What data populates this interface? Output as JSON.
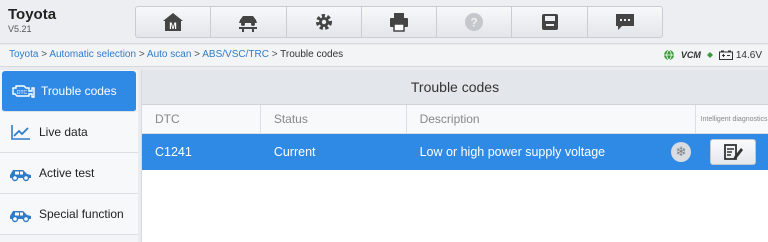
{
  "app": {
    "title": "Toyota",
    "version": "V5.21"
  },
  "toolbar": {
    "buttons": [
      {
        "icon": "home-icon"
      },
      {
        "icon": "vehicle-lift-icon"
      },
      {
        "icon": "gear-icon"
      },
      {
        "icon": "printer-icon"
      },
      {
        "icon": "help-icon"
      },
      {
        "icon": "save-icon"
      },
      {
        "icon": "message-icon"
      }
    ]
  },
  "breadcrumb": {
    "items": [
      "Toyota",
      "Automatic selection",
      "Auto scan",
      "ABS/VSC/TRC",
      "Trouble codes"
    ],
    "separator": ">"
  },
  "status": {
    "vcm_label": "VCM",
    "voltage": "14.6V"
  },
  "sidebar": {
    "items": [
      {
        "label": "Trouble codes",
        "icon": "engine-dtc-icon",
        "active": true
      },
      {
        "label": "Live data",
        "icon": "chart-line-icon",
        "active": false
      },
      {
        "label": "Active test",
        "icon": "car-icon",
        "active": false
      },
      {
        "label": "Special function",
        "icon": "car-icon",
        "active": false
      }
    ]
  },
  "main": {
    "title": "Trouble codes",
    "columns": [
      "DTC",
      "Status",
      "Description",
      "Intelligent diagnostics"
    ],
    "rows": [
      {
        "dtc": "C1241",
        "status": "Current",
        "description": "Low or high power supply voltage"
      }
    ]
  },
  "colors": {
    "accent": "#2f8ae6",
    "link": "#2f7cc9"
  }
}
